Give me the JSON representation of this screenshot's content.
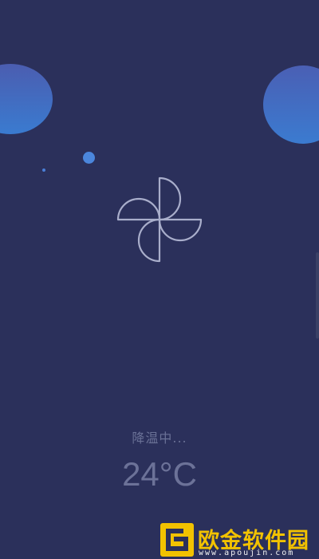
{
  "status": {
    "label": "降温中..."
  },
  "temperature": {
    "value": "24°C"
  },
  "fan": {
    "icon": "pinwheel-fan-icon"
  },
  "watermark": {
    "title": "欧金软件园",
    "url": "www.apoujin.com"
  },
  "colors": {
    "background": "#2b305b",
    "bubble": "#3f73c8",
    "text": "#6c7298",
    "fan_stroke": "#a9aecb",
    "watermark": "#f2c200"
  }
}
